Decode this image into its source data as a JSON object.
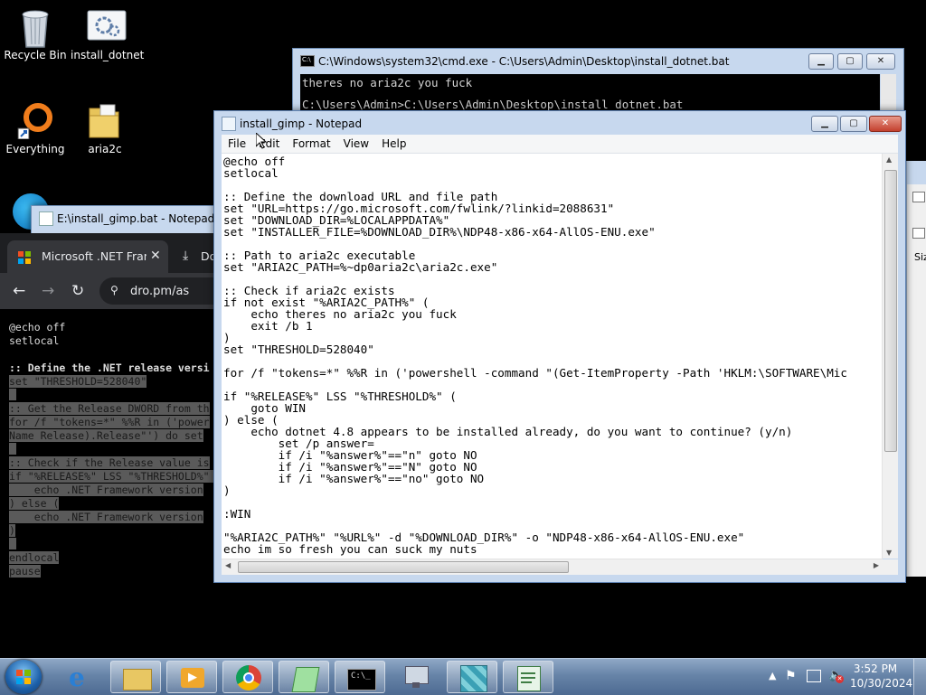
{
  "desktop": {
    "icons": [
      {
        "label": "Recycle Bin",
        "icon": "recycle-bin-icon"
      },
      {
        "label": "install_dotnet",
        "icon": "batch-file-icon"
      },
      {
        "label": "Everything",
        "icon": "everything-search-icon"
      },
      {
        "label": "aria2c",
        "icon": "folder-icon"
      }
    ]
  },
  "cmd_window": {
    "title": "C:\\Windows\\system32\\cmd.exe - C:\\Users\\Admin\\Desktop\\install_dotnet.bat",
    "lines": [
      "theres no aria2c you fuck",
      "",
      "C:\\Users\\Admin>C:\\Users\\Admin\\Desktop\\install_dotnet.bat"
    ]
  },
  "npp_window": {
    "title": "E:\\install_gimp.bat - Notepad++"
  },
  "browser": {
    "tab_title": "Microsoft .NET Fram",
    "tab2_title": "Do",
    "address": "dro.pm/as",
    "lines": [
      {
        "text": "@echo off",
        "style": "plain"
      },
      {
        "text": "setlocal",
        "style": "plain"
      },
      {
        "text": "",
        "style": "plain"
      },
      {
        "text": ":: Define the .NET release versi",
        "style": "bold"
      },
      {
        "text": "set \"THRESHOLD=528040\"",
        "style": "hl"
      },
      {
        "text": "",
        "style": "hl"
      },
      {
        "text": ":: Get the Release DWORD from th",
        "style": "hl"
      },
      {
        "text": "for /f \"tokens=*\" %%R in ('power",
        "style": "hl"
      },
      {
        "text": "Name Release).Release\"') do set",
        "style": "hl"
      },
      {
        "text": "",
        "style": "hl"
      },
      {
        "text": ":: Check if the Release value is",
        "style": "hl"
      },
      {
        "text": "if \"%RELEASE%\" LSS \"%THRESHOLD%\" (",
        "style": "hl"
      },
      {
        "text": "    echo .NET Framework version",
        "style": "hl"
      },
      {
        "text": ") else (",
        "style": "hl"
      },
      {
        "text": "    echo .NET Framework version",
        "style": "hl"
      },
      {
        "text": ")",
        "style": "hl"
      },
      {
        "text": "",
        "style": "hl"
      },
      {
        "text": "endlocal",
        "style": "hl"
      },
      {
        "text": "pause",
        "style": "hl"
      }
    ]
  },
  "notepad": {
    "title": "install_gimp - Notepad",
    "menu": [
      "File",
      "Edit",
      "Format",
      "View",
      "Help"
    ],
    "content": "@echo off\nsetlocal\n\n:: Define the download URL and file path\nset \"URL=https://go.microsoft.com/fwlink/?linkid=2088631\"\nset \"DOWNLOAD_DIR=%LOCALAPPDATA%\"\nset \"INSTALLER_FILE=%DOWNLOAD_DIR%\\NDP48-x86-x64-AllOS-ENU.exe\"\n\n:: Path to aria2c executable\nset \"ARIA2C_PATH=%~dp0aria2c\\aria2c.exe\"\n\n:: Check if aria2c exists\nif not exist \"%ARIA2C_PATH%\" (\n    echo theres no aria2c you fuck\n    exit /b 1\n)\nset \"THRESHOLD=528040\"\n\nfor /f \"tokens=*\" %%R in ('powershell -command \"(Get-ItemProperty -Path 'HKLM:\\SOFTWARE\\Mic\n\nif \"%RELEASE%\" LSS \"%THRESHOLD%\" (\n    goto WIN\n) else (\n    echo dotnet 4.8 appears to be installed already, do you want to continue? (y/n)\n        set /p answer=\n        if /i \"%answer%\"==\"n\" goto NO\n        if /i \"%answer%\"==\"N\" goto NO\n        if /i \"%answer%\"==\"no\" goto NO\n)\n\n:WIN\n\n\"%ARIA2C_PATH%\" \"%URL%\" -d \"%DOWNLOAD_DIR%\" -o \"NDP48-x86-x64-AllOS-ENU.exe\"\necho im so fresh you can suck my nuts"
  },
  "right_window": {
    "label": "Siz"
  },
  "taskbar": {
    "items": [
      {
        "name": "start-button",
        "icon": "windows-logo-icon"
      },
      {
        "name": "internet-explorer",
        "icon": "ie-icon"
      },
      {
        "name": "file-explorer",
        "icon": "folder-icon"
      },
      {
        "name": "media-player",
        "icon": "media-player-icon"
      },
      {
        "name": "chrome",
        "icon": "chrome-icon"
      },
      {
        "name": "notepad-plus",
        "icon": "notepad-plus-icon"
      },
      {
        "name": "cmd",
        "icon": "cmd-icon"
      },
      {
        "name": "network",
        "icon": "network-icon"
      },
      {
        "name": "dotnet-installer",
        "icon": "installer-icon"
      },
      {
        "name": "notepad",
        "icon": "notepad-icon"
      }
    ],
    "clock_time": "3:52 PM",
    "clock_date": "10/30/2024"
  },
  "colors": {
    "taskbar": "#6784a8",
    "window_frame": "#c7d8ee",
    "close_button": "#c3402e"
  }
}
